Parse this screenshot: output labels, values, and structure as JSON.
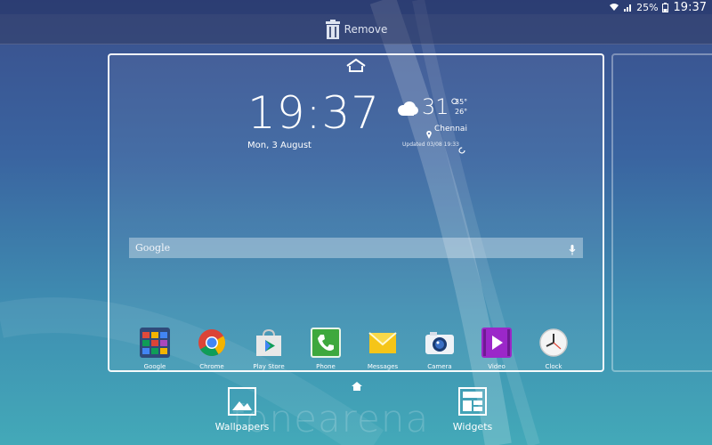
{
  "status_bar": {
    "battery": "25%",
    "time": "19:37"
  },
  "remove_bar": {
    "label": "Remove"
  },
  "clock_widget": {
    "time": "19:37",
    "date": "Mon, 3 August"
  },
  "weather_widget": {
    "temp": "31°",
    "high": "35°",
    "low": "26°",
    "city": "Chennai",
    "updated": "Updated 03/08 19:33"
  },
  "search_bar": {
    "label": "Google"
  },
  "dock_apps": [
    {
      "label": "Google"
    },
    {
      "label": "Chrome"
    },
    {
      "label": "Play Store"
    },
    {
      "label": "Phone"
    },
    {
      "label": "Messages"
    },
    {
      "label": "Camera"
    },
    {
      "label": "Video"
    },
    {
      "label": "Clock"
    }
  ],
  "bottom_options": {
    "wallpapers": "Wallpapers",
    "widgets": "Widgets"
  },
  "watermark": "fonearena"
}
